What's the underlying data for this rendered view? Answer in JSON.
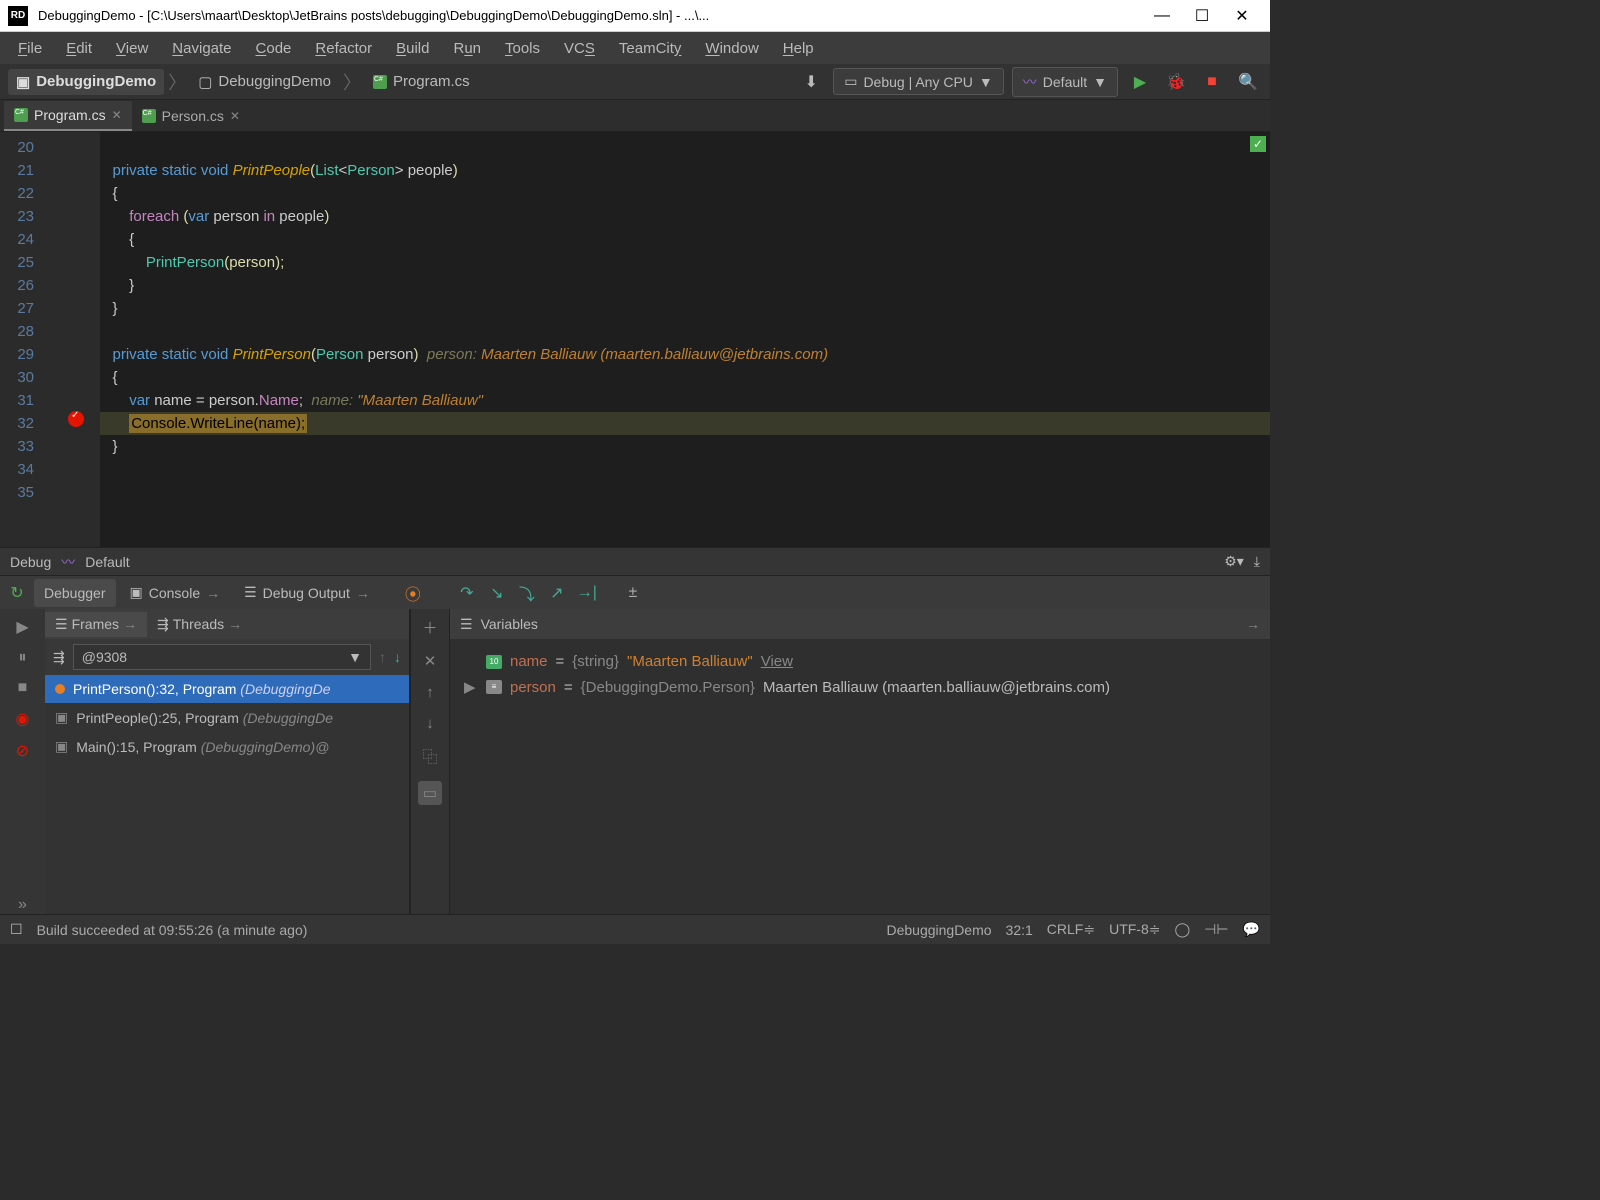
{
  "titlebar": {
    "logo": "RD",
    "text": "DebuggingDemo - [C:\\Users\\maart\\Desktop\\JetBrains posts\\debugging\\DebuggingDemo\\DebuggingDemo.sln] - ...\\..."
  },
  "menu": [
    "File",
    "Edit",
    "View",
    "Navigate",
    "Code",
    "Refactor",
    "Build",
    "Run",
    "Tools",
    "VCS",
    "TeamCity",
    "Window",
    "Help"
  ],
  "breadcrumb": {
    "root": "DebuggingDemo",
    "mid": "DebuggingDemo",
    "file": "Program.cs"
  },
  "toolbar": {
    "config": "Debug | Any CPU",
    "runconfig": "Default"
  },
  "tabs": [
    {
      "name": "Program.cs",
      "active": true
    },
    {
      "name": "Person.cs",
      "active": false
    }
  ],
  "editor": {
    "firstLine": 20,
    "lastLine": 35,
    "breakpointLine": 32
  },
  "code": {
    "l21": {
      "sig_pre": "private static void ",
      "method": "PrintPeople",
      "params": "(List<Person> people)"
    },
    "l23": {
      "pre": "foreach ",
      "paren": "(",
      "var": "var",
      "rest": " person ",
      "in": "in",
      "rest2": " people)"
    },
    "l25": {
      "call": "PrintPerson",
      "args": "(person);"
    },
    "l29": {
      "sig_pre": "private static void ",
      "method": "PrintPerson",
      "params": "(Person person)",
      "hint": "  person: ",
      "hintval": "Maarten Balliauw (maarten.balliauw@jetbrains.com)"
    },
    "l31": {
      "pre": "var",
      "rest": " name = person.",
      "prop": "Name",
      "semi": ";",
      "hint": "  name: ",
      "hintval": "\"Maarten Balliauw\""
    },
    "l32": {
      "text": "Console.WriteLine(name);"
    }
  },
  "debug": {
    "title": "Debug",
    "config": "Default",
    "tabs": {
      "debugger": "Debugger",
      "console": "Console",
      "output": "Debug Output"
    },
    "frames": {
      "tab_frames": "Frames",
      "tab_threads": "Threads",
      "thread": "@9308",
      "rows": [
        {
          "text": "PrintPerson():32, Program ",
          "grey": "(DebuggingDe",
          "selected": true,
          "dot": true
        },
        {
          "text": "PrintPeople():25, Program ",
          "grey": "(DebuggingDe",
          "selected": false,
          "dot": false
        },
        {
          "text": "Main():15, Program ",
          "grey": "(DebuggingDemo)@",
          "selected": false,
          "dot": false
        }
      ]
    },
    "vars": {
      "title": "Variables",
      "rows": [
        {
          "name": "name",
          "eq": " = ",
          "type": "{string} ",
          "val": "\"Maarten Balliauw\" ",
          "view": "View",
          "expandable": false
        },
        {
          "name": "person",
          "eq": " = ",
          "type": "{DebuggingDemo.Person} ",
          "val": "Maarten Balliauw (maarten.balliauw@jetbrains.com)",
          "view": "",
          "expandable": true
        }
      ]
    }
  },
  "status": {
    "msg": "Build succeeded at 09:55:26 (a minute ago)",
    "context": "DebuggingDemo",
    "pos": "32:1",
    "eol": "CRLF",
    "enc": "UTF-8"
  }
}
